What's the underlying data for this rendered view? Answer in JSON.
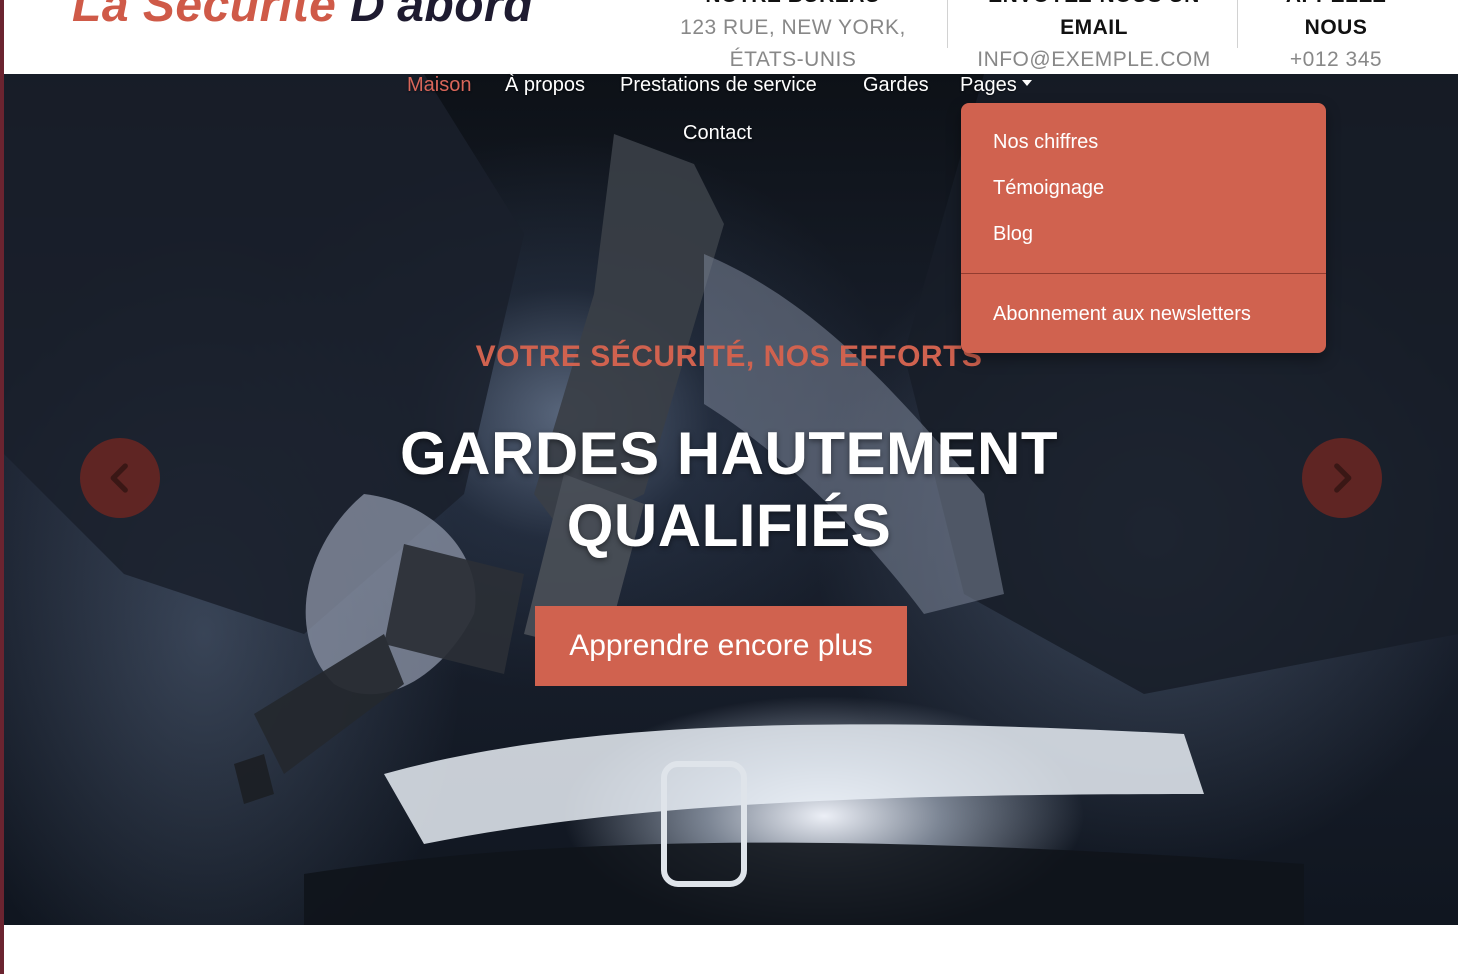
{
  "brand": {
    "name_part_1": "La Sécurité ",
    "name_part_2": "D'abord"
  },
  "header": {
    "office": {
      "title": "Notre bureau",
      "line1": "123 Rue, New York,",
      "line2": "États-Unis"
    },
    "email": {
      "title": "Envoyez-nous un",
      "title2": "email",
      "value": "info@exemple.com"
    },
    "phone": {
      "title": "Appelez",
      "title2": "nous",
      "value": "+012 345"
    }
  },
  "nav": {
    "items": [
      "Maison",
      "À propos",
      "Prestations de service",
      "Gardes",
      "Pages",
      "Contact"
    ],
    "active": "Maison"
  },
  "dropdown": {
    "items": [
      "Nos chiffres",
      "Témoignage",
      "Blog"
    ],
    "footer_item": "Abonnement aux newsletters"
  },
  "hero": {
    "subtitle": "Votre sécurité, nos efforts",
    "headline_line1": "Gardes hautement",
    "headline_line2": "qualifiés",
    "cta": "Apprendre encore plus"
  },
  "carousel": {
    "prev_icon": "chevron-left-icon",
    "next_icon": "chevron-right-icon"
  },
  "colors": {
    "accent": "#d0624f",
    "dark": "#1e1b30",
    "muted": "#888888"
  }
}
